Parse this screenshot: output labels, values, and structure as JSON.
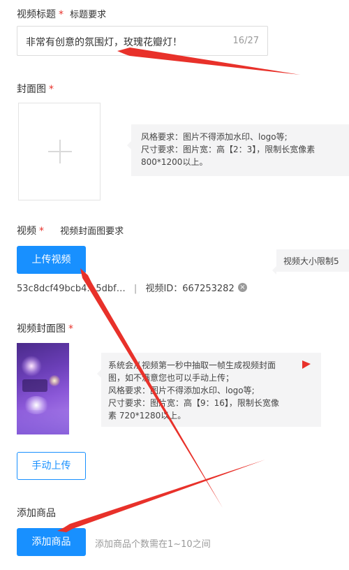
{
  "title_section": {
    "label": "视频标题",
    "required_mark": "*",
    "requirement_link": "标题要求",
    "input_value": "非常有创意的氛围灯，玫瑰花瓣灯！",
    "char_count": "16/27"
  },
  "cover_section": {
    "label": "封面图",
    "required_mark": "*",
    "tip_line1": "风格要求：图片不得添加水印、logo等;",
    "tip_line2": "尺寸要求：图片宽：高【2：3】，限制长宽像素",
    "tip_line3": "800*1200以上。"
  },
  "video_section": {
    "label": "视频",
    "required_mark": "*",
    "requirement_link": "视频封面图要求",
    "upload_button": "上传视频",
    "size_tip": "视频大小限制5",
    "file_name": "53c8dcf49bcb4…5dbf…",
    "separator": "|",
    "video_id": "视频ID：667253282",
    "remove_icon": "×"
  },
  "video_cover_section": {
    "label": "视频封面图",
    "required_mark": "*",
    "tip_line1": "系统会从视频第一秒中抽取一帧生成视频封面",
    "tip_line2": "图，如不满意您也可以手动上传；",
    "tip_line3": "风格要求：图片不得添加水印、logo等;",
    "tip_line4": "尺寸要求：图片宽：高【9：16】，限制长宽像",
    "tip_line5": "素 720*1280以上。",
    "manual_upload_button": "手动上传"
  },
  "product_section": {
    "label": "添加商品",
    "add_button": "添加商品",
    "hint": "添加商品个数需在1~10之间"
  },
  "colors": {
    "primary": "#1890ff",
    "required": "#e8312a",
    "annotation_arrow": "#e8312a"
  }
}
